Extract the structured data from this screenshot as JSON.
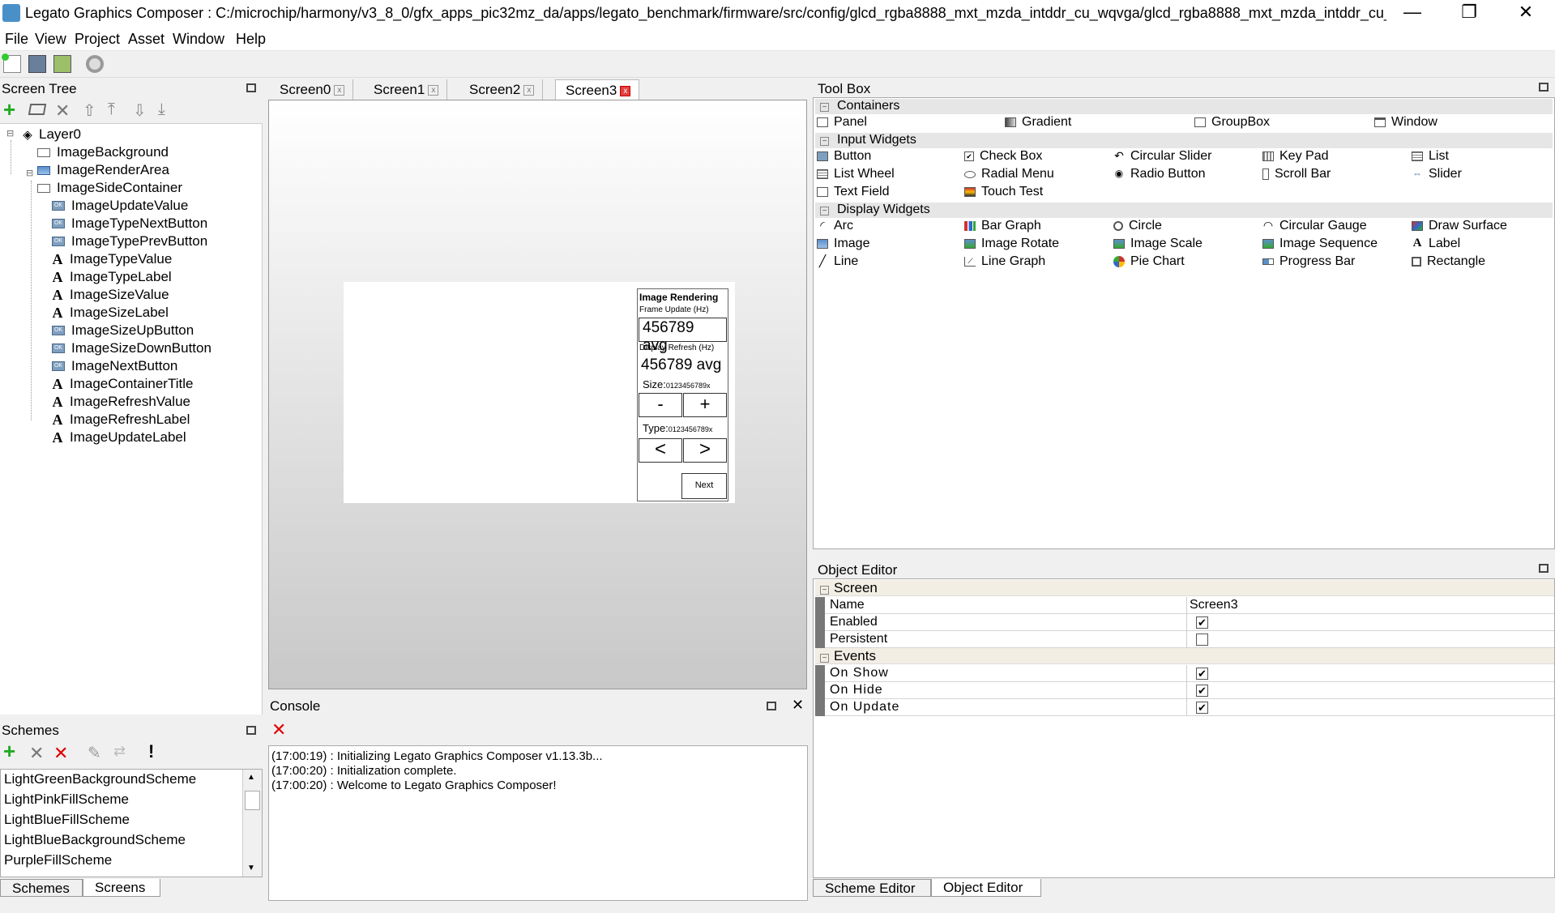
{
  "window": {
    "title": "Legato Graphics Composer : C:/microchip/harmony/v3_8_0/gfx_apps_pic32mz_da/apps/legato_benchmark/firmware/src/config/glcd_rgba8888_mxt_mzda_intddr_cu_wqvga/glcd_rgba8888_mxt_mzda_intddr_cu_...",
    "minimize": "—",
    "restore": "❐",
    "close": "✕"
  },
  "menu": [
    "File",
    "View",
    "Project",
    "Asset",
    "Window",
    "Help"
  ],
  "screen_tree": {
    "title": "Screen Tree",
    "nodes": [
      {
        "label": "Layer0",
        "icon": "layer-icon"
      },
      {
        "label": "ImageBackground",
        "icon": "panel-icon"
      },
      {
        "label": "ImageRenderArea",
        "icon": "image-icon"
      },
      {
        "label": "ImageSideContainer",
        "icon": "panel-icon"
      },
      {
        "label": "ImageUpdateValue",
        "icon": "button-icon"
      },
      {
        "label": "ImageTypeNextButton",
        "icon": "button-icon"
      },
      {
        "label": "ImageTypePrevButton",
        "icon": "button-icon"
      },
      {
        "label": "ImageTypeValue",
        "icon": "label-icon"
      },
      {
        "label": "ImageTypeLabel",
        "icon": "label-icon"
      },
      {
        "label": "ImageSizeValue",
        "icon": "label-icon"
      },
      {
        "label": "ImageSizeLabel",
        "icon": "label-icon"
      },
      {
        "label": "ImageSizeUpButton",
        "icon": "button-icon"
      },
      {
        "label": "ImageSizeDownButton",
        "icon": "button-icon"
      },
      {
        "label": "ImageNextButton",
        "icon": "button-icon"
      },
      {
        "label": "ImageContainerTitle",
        "icon": "label-icon"
      },
      {
        "label": "ImageRefreshValue",
        "icon": "label-icon"
      },
      {
        "label": "ImageRefreshLabel",
        "icon": "label-icon"
      },
      {
        "label": "ImageUpdateLabel",
        "icon": "label-icon"
      }
    ]
  },
  "tabs": [
    "Screen0",
    "Screen1",
    "Screen2",
    "Screen3"
  ],
  "active_tab": "Screen3",
  "preview": {
    "title": "Image Rendering",
    "frame_update_label": "Frame Update (Hz)",
    "frame_update_value": "456789 avg",
    "display_refresh_label": "Display Refresh (Hz)",
    "display_refresh_value": "456789 avg",
    "size_label": "Size:",
    "size_value": "0123456789x",
    "minus": "-",
    "plus": "+",
    "type_label": "Type:",
    "type_value": "0123456789x",
    "prev": "<",
    "next_arrow": ">",
    "next_button": "Next"
  },
  "schemes": {
    "title": "Schemes",
    "items": [
      "LightGreenBackgroundScheme",
      "LightPinkFillScheme",
      "LightBlueFillScheme",
      "LightBlueBackgroundScheme",
      "PurpleFillScheme"
    ],
    "tabs": [
      "Schemes",
      "Screens"
    ]
  },
  "console": {
    "title": "Console",
    "lines": [
      "(17:00:19) : Initializing Legato Graphics Composer v1.13.3b...",
      "(17:00:20) : Initialization complete.",
      "(17:00:20) : Welcome to Legato Graphics Composer!"
    ]
  },
  "toolbox": {
    "title": "Tool Box",
    "categories": [
      {
        "name": "Containers",
        "items": [
          "Panel",
          "Gradient",
          "GroupBox",
          "Window"
        ]
      },
      {
        "name": "Input Widgets",
        "items": [
          "Button",
          "Check Box",
          "Circular Slider",
          "Key Pad",
          "List",
          "List Wheel",
          "Radial Menu",
          "Radio Button",
          "Scroll Bar",
          "Slider",
          "Text Field",
          "Touch Test"
        ]
      },
      {
        "name": "Display Widgets",
        "items": [
          "Arc",
          "Bar Graph",
          "Circle",
          "Circular Gauge",
          "Draw Surface",
          "Image",
          "Image Rotate",
          "Image Scale",
          "Image Sequence",
          "Label",
          "Line",
          "Line Graph",
          "Pie Chart",
          "Progress Bar",
          "Rectangle"
        ]
      }
    ]
  },
  "object_editor": {
    "title": "Object Editor",
    "screen_group": "Screen",
    "name_label": "Name",
    "name_value": "Screen3",
    "enabled_label": "Enabled",
    "enabled": true,
    "persistent_label": "Persistent",
    "persistent": false,
    "events_group": "Events",
    "events": [
      {
        "label": "On Show",
        "checked": true
      },
      {
        "label": "On Hide",
        "checked": true
      },
      {
        "label": "On Update",
        "checked": true
      }
    ],
    "tabs": [
      "Scheme Editor",
      "Object Editor"
    ]
  },
  "check_mark": "✔"
}
